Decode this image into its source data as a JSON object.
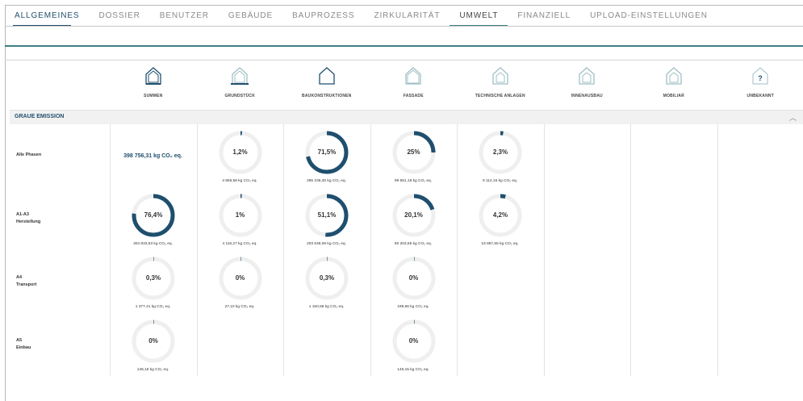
{
  "tabs": [
    {
      "label": "ALLGEMEINES",
      "state": "active-blue"
    },
    {
      "label": "DOSSIER",
      "state": ""
    },
    {
      "label": "BENUTZER",
      "state": ""
    },
    {
      "label": "GEBÄUDE",
      "state": ""
    },
    {
      "label": "BAUPROZESS",
      "state": ""
    },
    {
      "label": "ZIRKULARITÄT",
      "state": ""
    },
    {
      "label": "UMWELT",
      "state": "active-teal"
    },
    {
      "label": "FINANZIELL",
      "state": ""
    },
    {
      "label": "UPLOAD-EINSTELLUNGEN",
      "state": ""
    }
  ],
  "categories": [
    {
      "label": "SUMMEN",
      "icon": "house-full-icon"
    },
    {
      "label": "GRUNDSTÜCK",
      "icon": "house-ground-icon"
    },
    {
      "label": "BAUKONSTRUKTIONEN",
      "icon": "house-outline-icon"
    },
    {
      "label": "FASSADE",
      "icon": "house-facade-icon"
    },
    {
      "label": "TECHNISCHE ANLAGEN",
      "icon": "house-technical-icon"
    },
    {
      "label": "INNENAUSBAU",
      "icon": "house-interior-icon"
    },
    {
      "label": "MOBILIAR",
      "icon": "house-furniture-icon"
    },
    {
      "label": "UNBEKANNT",
      "icon": "house-unknown-icon"
    }
  ],
  "section": {
    "title": "GRAUE EMISSION",
    "collapse_icon": "chevron-up-icon"
  },
  "colors": {
    "accent": "#1f4f6e",
    "teal": "#3f7f85",
    "ring_bg": "#efefef"
  },
  "rows": [
    {
      "label": "Alle Phasen",
      "total": "398 756,31 kg CO₂ eq.",
      "cells": [
        null,
        {
          "pct": "1,2%",
          "fraction": 0.012,
          "value": "4 856,58 kg CO₂ eq."
        },
        {
          "pct": "71,5%",
          "fraction": 0.715,
          "value": "285 236,30 kg CO₂ eq."
        },
        {
          "pct": "25%",
          "fraction": 0.25,
          "value": "99 551,18 kg CO₂ eq."
        },
        {
          "pct": "2,3%",
          "fraction": 0.023,
          "value": "9 112,16 kg CO₂ eq."
        }
      ]
    },
    {
      "label": "A1-A3\nHerstellung",
      "cells": [
        {
          "pct": "76,4%",
          "fraction": 0.764,
          "value": "304 833,53 kg CO₂ eq."
        },
        {
          "pct": "1%",
          "fraction": 0.01,
          "value": "4 116,27 kg CO₂ eq."
        },
        {
          "pct": "51,1%",
          "fraction": 0.511,
          "value": "203 648,06 kg CO₂ eq."
        },
        {
          "pct": "20,1%",
          "fraction": 0.201,
          "value": "80 203,55 kg CO₂ eq."
        },
        {
          "pct": "4,2%",
          "fraction": 0.042,
          "value": "16 867,65 kg CO₂ eq."
        }
      ]
    },
    {
      "label": "A4\nTransport",
      "cells": [
        {
          "pct": "0,3%",
          "fraction": 0.003,
          "value": "1 377,41 kg CO₂ eq."
        },
        {
          "pct": "0%",
          "fraction": 0,
          "value": "27,10 kg CO₂ eq."
        },
        {
          "pct": "0,3%",
          "fraction": 0.003,
          "value": "1 150,58 kg CO₂ eq."
        },
        {
          "pct": "0%",
          "fraction": 0,
          "value": "199,66 kg CO₂ eq."
        },
        null
      ]
    },
    {
      "label": "A5\nEinbau",
      "cells": [
        {
          "pct": "0%",
          "fraction": 0,
          "value": "146,15 kg CO₂ eq."
        },
        null,
        null,
        {
          "pct": "0%",
          "fraction": 0,
          "value": "146,15 kg CO₂ eq."
        },
        null
      ]
    }
  ]
}
